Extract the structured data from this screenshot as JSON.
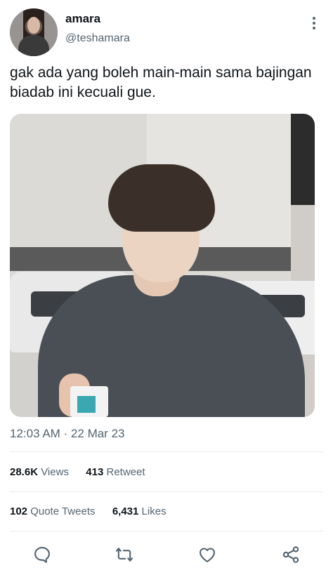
{
  "user": {
    "display_name": "amara",
    "handle": "@teshamara"
  },
  "tweet": {
    "text": "gak ada yang boleh main-main sama bajingan biadab ini kecuali gue.",
    "timestamp": "12:03 AM · 22 Mar 23"
  },
  "stats": {
    "views_count": "28.6K",
    "views_label": "Views",
    "retweets_count": "413",
    "retweets_label": "Retweet",
    "quotes_count": "102",
    "quotes_label": "Quote Tweets",
    "likes_count": "6,431",
    "likes_label": "Likes"
  },
  "icons": {
    "reply": "reply-icon",
    "retweet": "retweet-icon",
    "like": "heart-icon",
    "share": "share-icon",
    "more": "more-vertical-icon"
  },
  "colors": {
    "text": "#0f1419",
    "secondary": "#536471",
    "divider": "#e6ecf0"
  }
}
